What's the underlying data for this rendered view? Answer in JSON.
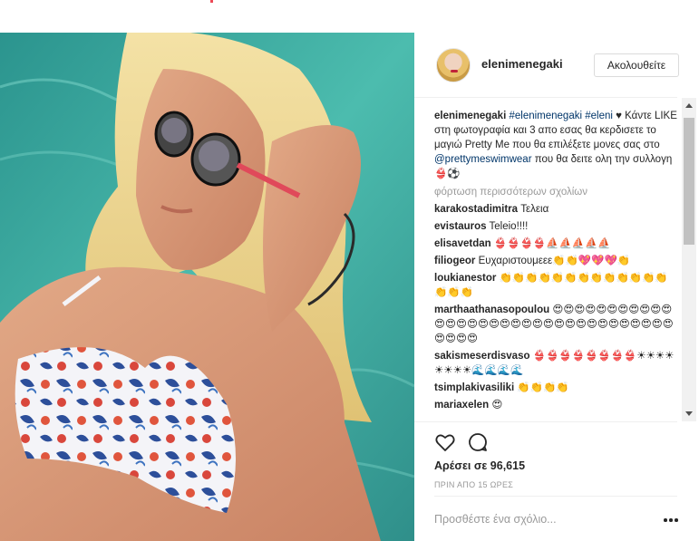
{
  "post": {
    "username": "elenimenegaki",
    "follow_label": "Ακολουθείτε",
    "caption": {
      "user": "elenimenegaki",
      "tags": "#elenimenegaki #eleni",
      "heart": "♥",
      "text_1": "Κάντε LIKE στη φωτογραφία και 3 απο εσας θα κερδισετε το μαγιώ Pretty Me που θα επιλέξετε μονες σας στο",
      "mention": "@prettymeswimwear",
      "text_2": "που θα δειτε ολη την συλλογη👙⚽"
    },
    "load_more_label": "φόρτωση περισσότερων σχολίων",
    "comments": [
      {
        "user": "karakostadimitra",
        "text": "Τελεια"
      },
      {
        "user": "evistauros",
        "text": "Teleio!!!!"
      },
      {
        "user": "elisavetdan",
        "text": "👙👙👙👙⛵⛵⛵⛵⛵"
      },
      {
        "user": "filiogeor",
        "text": "Ευχαριστουμεεε👏👏💖💖💖👏"
      },
      {
        "user": "loukianestor",
        "text": "👏👏👏👏👏👏👏👏👏👏👏👏👏👏👏👏"
      },
      {
        "user": "marthaathanasopoulou",
        "text": "😍😍😍😍😍😍😍😍😍😍😍😍😍😍😍😍😍😍😍😍😍😍😍😍😍😍😍😍😍😍😍😍😍😍😍😍😍"
      },
      {
        "user": "sakismeserdisvaso",
        "text": "👙👙👙👙👙👙👙👙☀☀☀☀☀☀☀☀🌊🌊🌊🌊"
      },
      {
        "user": "tsimplakivasiliki",
        "text": "👏👏👏👏"
      },
      {
        "user": "mariaxelen",
        "text": "😍"
      }
    ],
    "likes_label": "Αρέσει σε 96,615",
    "time_label": "ΠΡΙΝ ΑΠΟ 15 ΩΡΕΣ",
    "add_comment_placeholder": "Προσθέστε ένα σχόλιο..."
  },
  "icons": {
    "heart": "heart-outline-icon",
    "comment": "comment-bubble-icon",
    "more": "more-options-icon"
  },
  "colors": {
    "link": "#003569",
    "muted": "#999999",
    "text": "#262626",
    "border": "#dbdbdb"
  }
}
